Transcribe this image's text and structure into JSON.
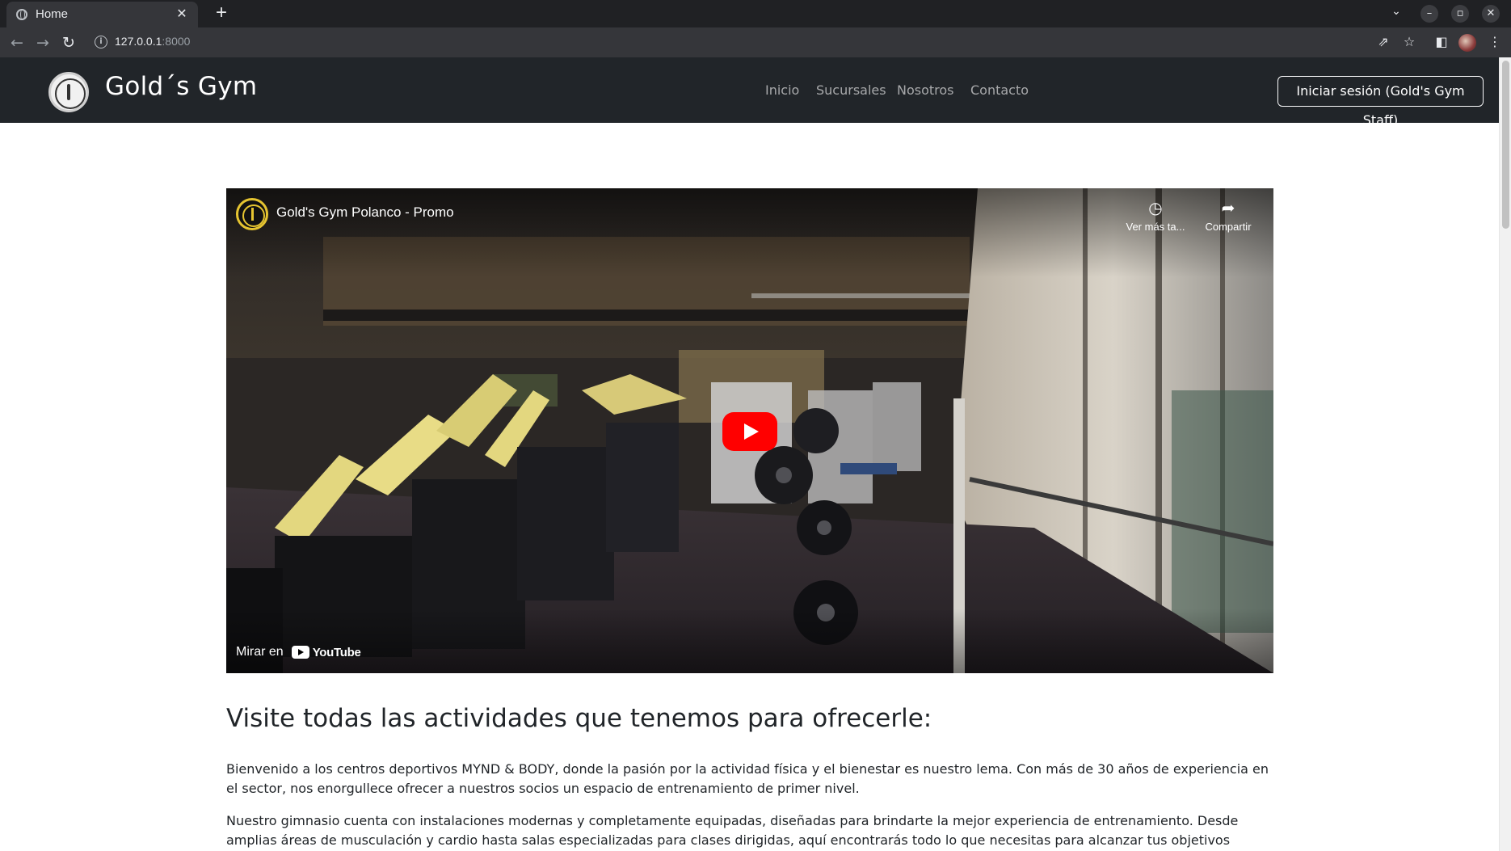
{
  "browser": {
    "tab_title": "Home",
    "tab_close": "✕",
    "new_tab": "+",
    "url_host": "127.0.0.1",
    "url_port": ":8000",
    "icons": [
      "back-icon",
      "forward-icon",
      "reload-icon",
      "site-info-icon",
      "share-icon",
      "bookmark-star-icon",
      "side-panel-icon",
      "profile-avatar",
      "menu-icon"
    ]
  },
  "site": {
    "brand": "Gold´s Gym",
    "nav": [
      "Inicio",
      "Sucursales",
      "Nosotros",
      "Contacto"
    ],
    "login_label": "Iniciar sesión (Gold's Gym Staff)"
  },
  "video": {
    "title": "Gold's Gym Polanco - Promo",
    "watch_later": "Ver más ta...",
    "share": "Compartir",
    "watch_on": "Mirar en",
    "youtube": "YouTube"
  },
  "content": {
    "heading": "Visite todas las actividades que tenemos para ofrecerle:",
    "paragraphs": [
      "Bienvenido a los centros deportivos MYND & BODY, donde la pasión por la actividad física y el bienestar es nuestro lema. Con más de 30 años de experiencia en el sector, nos enorgullece ofrecer a nuestros socios un espacio de entrenamiento de primer nivel.",
      "Nuestro gimnasio cuenta con instalaciones modernas y completamente equipadas, diseñadas para brindarte la mejor experiencia de entrenamiento. Desde amplias áreas de musculación y cardio hasta salas especializadas para clases dirigidas, aquí encontrarás todo lo que necesitas para alcanzar tus objetivos fitness."
    ]
  },
  "colors": {
    "navbar": "#212529",
    "youtube_red": "#ff0000",
    "text": "#212529"
  }
}
